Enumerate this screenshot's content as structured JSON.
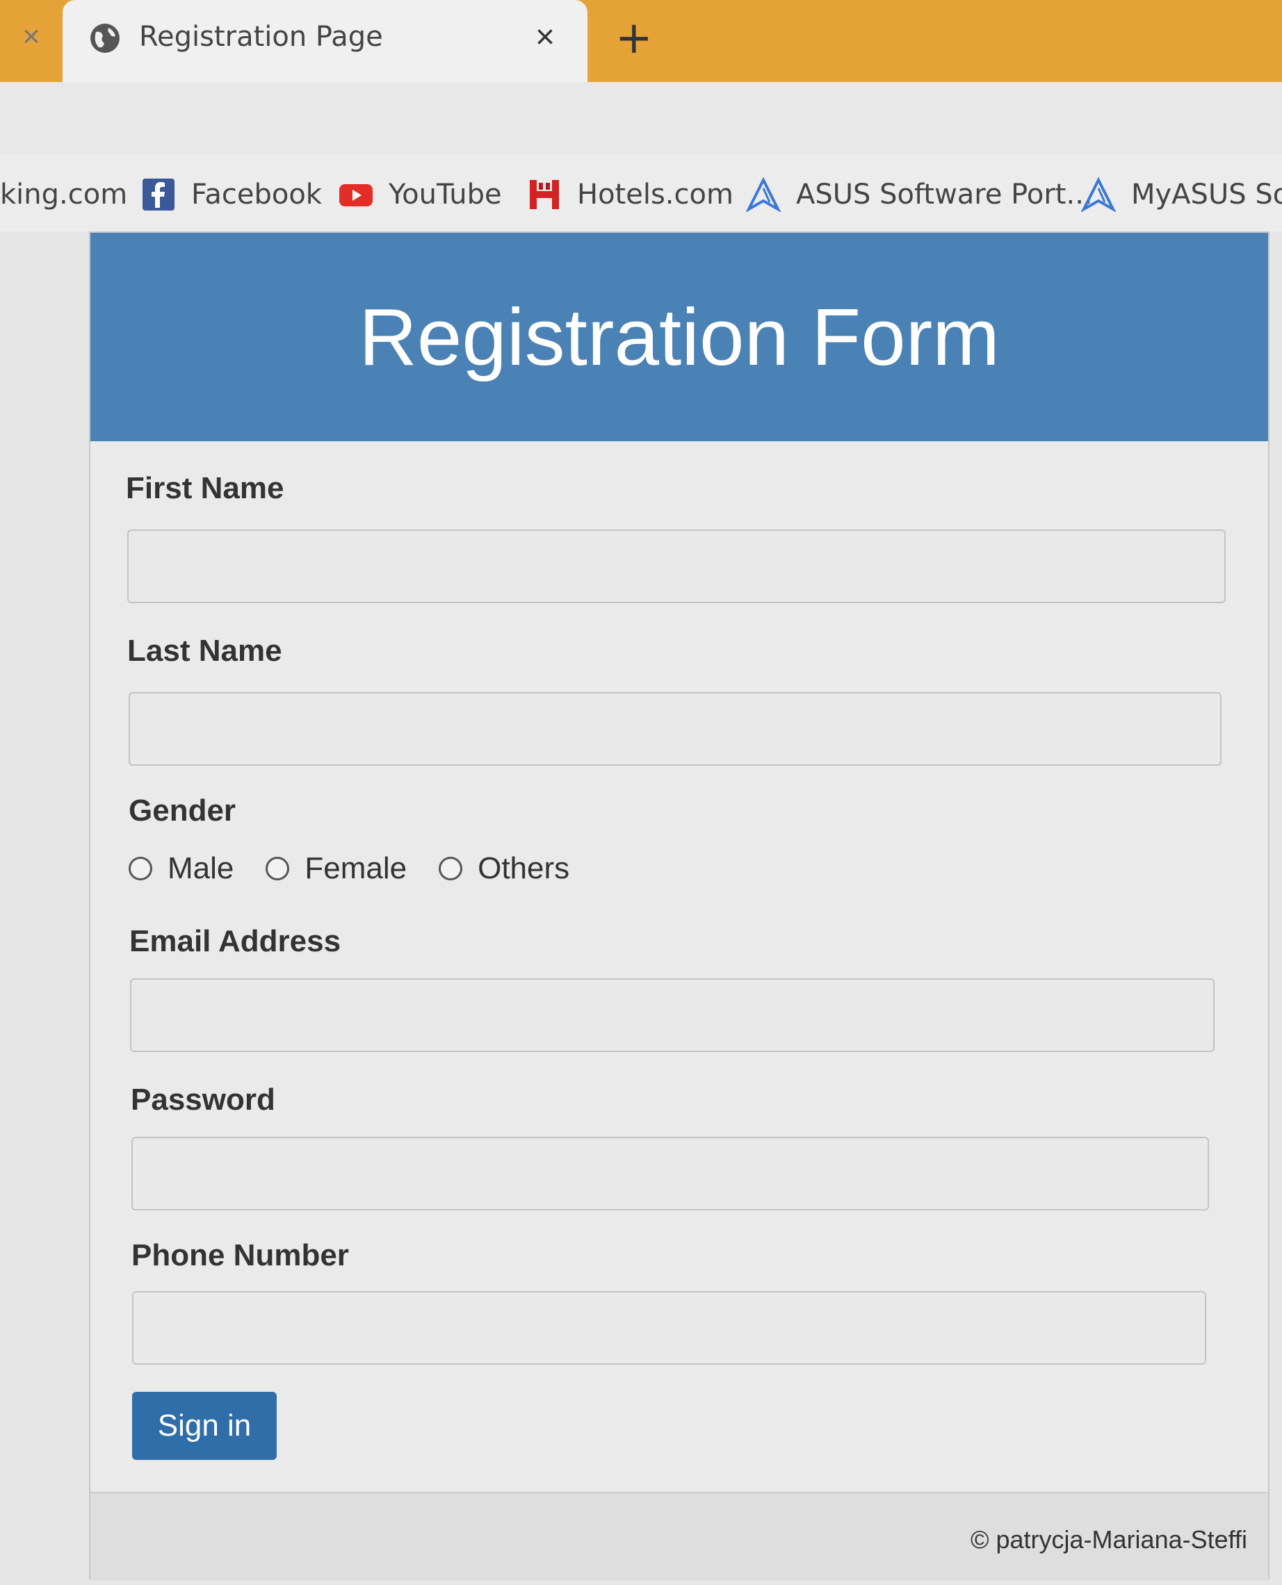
{
  "browser": {
    "tab_title": "Registration Page",
    "tab_close": "×",
    "left_tab_close": "×",
    "new_tab": "+",
    "accent_color": "#e5a236"
  },
  "bookmarks": [
    {
      "label": "king.com",
      "icon": "none"
    },
    {
      "label": "Facebook",
      "icon": "facebook-icon"
    },
    {
      "label": "YouTube",
      "icon": "youtube-icon"
    },
    {
      "label": "Hotels.com",
      "icon": "hotels-icon"
    },
    {
      "label": "ASUS Software Port...",
      "icon": "asus-icon"
    },
    {
      "label": "MyASUS Sof",
      "icon": "asus-icon"
    }
  ],
  "form": {
    "title": "Registration Form",
    "header_color": "#4a82b6",
    "first_name_label": "First Name",
    "first_name_value": "",
    "last_name_label": "Last Name",
    "last_name_value": "",
    "gender_label": "Gender",
    "gender_options": [
      "Male",
      "Female",
      "Others"
    ],
    "email_label": "Email Address",
    "email_value": "",
    "password_label": "Password",
    "password_value": "",
    "phone_label": "Phone Number",
    "phone_value": "",
    "submit_label": "Sign in",
    "button_color": "#2f6ea8"
  },
  "footer": {
    "text": "© patrycja-Mariana-Steffi"
  }
}
